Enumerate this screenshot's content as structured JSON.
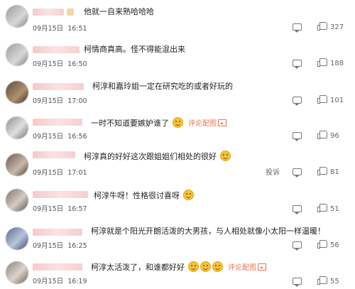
{
  "comments": [
    {
      "text": "他就一自来熟哈哈哈",
      "date": "09月15日",
      "time": "16:51",
      "likes": "327",
      "has_pic": false,
      "emojis": 0
    },
    {
      "text": "柯情商真高。怪不得能混出来",
      "date": "09月15日",
      "time": "16:50",
      "likes": "188",
      "has_pic": false,
      "emojis": 0
    },
    {
      "text": "柯淳和嘉玲姐一定在研究吃的或者好玩的",
      "date": "09月15日",
      "time": "17:00",
      "likes": "101",
      "has_pic": false,
      "emojis": 0
    },
    {
      "text": "一时不知道要嫉妒谁了",
      "date": "09月15日",
      "time": "16:56",
      "likes": "96",
      "has_pic": true,
      "emojis": 1
    },
    {
      "text": "柯淳真的好好这次跟姐姐们相处的很好",
      "date": "09月15日",
      "time": "17:01",
      "likes": "81",
      "has_pic": false,
      "emojis": 1,
      "report": "投诉"
    },
    {
      "text": "柯淳牛呀！性格很讨喜呀",
      "date": "09月15日",
      "time": "16:57",
      "likes": "51",
      "has_pic": false,
      "emojis": 1
    },
    {
      "text": "柯淳就是个阳光开朗活泼的大男孩，与人相处就像小太阳一样温暖！",
      "date": "09月15日",
      "time": "16:25",
      "likes": "56",
      "has_pic": false,
      "emojis": 0
    },
    {
      "text": "柯淳太活泼了，和谁都好好",
      "date": "09月15日",
      "time": "16:19",
      "likes": "55",
      "has_pic": true,
      "emojis": 3
    }
  ],
  "ui": {
    "pic_link_label": "评论配图",
    "comment_icon": "comment-icon",
    "like_icon": "thumbs-up-icon",
    "emoji_icon": "smiley-emoji-icon",
    "accent_color": "#eb7350"
  }
}
